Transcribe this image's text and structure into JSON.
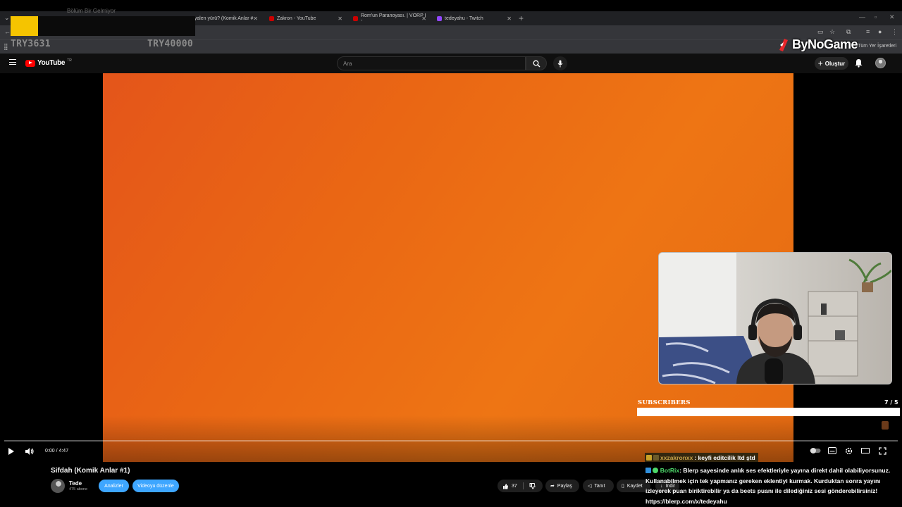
{
  "browser": {
    "tabs": [
      {
        "title": "onyalen yürü? (Komik Anlar #",
        "fav": "#cc0000"
      },
      {
        "title": "Zakron - YouTube",
        "fav": "#cc0000"
      },
      {
        "title": "Rom'un Paranoyası. | VORP I -",
        "fav": "#cc0000"
      },
      {
        "title": "tedeyahu - Twitch",
        "fav": "#9146ff"
      }
    ],
    "bookmarks_label": "Tüm Yer İşaretleri"
  },
  "overlay": {
    "sponsor_faint": "Bölüm Bir Gelmiyor",
    "counter_left": "TRY3631",
    "counter_right": "TRY40000",
    "brand": "ByNoGame"
  },
  "youtube": {
    "logo": "YouTube",
    "region": "TR",
    "search_placeholder": "Ara",
    "create_label": "Oluştur"
  },
  "player": {
    "time": "0:00 / 4:47",
    "progress": 0.0
  },
  "goal": {
    "label": "SUBSCRIBERS",
    "count": "7 / 5",
    "progress": 1.0
  },
  "video": {
    "title": "Sifdah (Komik Anlar #1)",
    "channel": "Tede",
    "subscribers": "475 abone",
    "analytics_label": "Analizler",
    "edit_label": "Videoyu düzenle",
    "likes": "37",
    "share_label": "Paylaş",
    "promote_label": "Tanıt",
    "save_label": "Kaydet",
    "download_label": "İndir"
  },
  "chat": {
    "user1": "xxzakronxx",
    "msg1": ": keyfi editcilik ltd ştd",
    "bot": "BotRix",
    "bot_msg": ": Blerp sayesinde anlık ses efektleriyle yayına direkt dahil olabiliyorsunuz. Kullanabilmek için tek yapmanız gereken eklentiyi kurmak. Kurduktan sonra yayını izleyerek puan biriktirebilir ya da beets puanı ile dilediğiniz sesi gönderebilirsiniz! https://blerp.com/x/tedeyahu"
  },
  "colors": {
    "video_orange": "#ea6714",
    "yt_red": "#ff0000",
    "yt_blue": "#3ea6ff",
    "sponsor_yellow": "#f5c400",
    "bot_green": "#4dd86a"
  }
}
